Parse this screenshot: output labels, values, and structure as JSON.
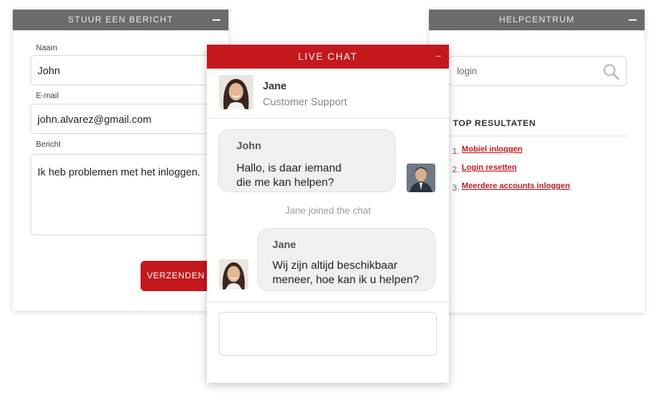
{
  "form": {
    "title": "Stuur een bericht",
    "name_label": "Naam",
    "name_value": "John",
    "email_label": "E-mail",
    "email_value": "john.alvarez@gmail.com",
    "message_label": "Bericht",
    "message_value": "Ik heb problemen met het inloggen.",
    "submit_label": "Verzenden"
  },
  "help": {
    "title": "Helpcentrum",
    "search_value": "login",
    "results_title": "Top resultaten",
    "results": [
      {
        "num": "1.",
        "label": "Mobiel inloggen"
      },
      {
        "num": "2.",
        "label": "Login resetten"
      },
      {
        "num": "3.",
        "label": "Meerdere accounts inloggen"
      }
    ]
  },
  "chat": {
    "title": "Live chat",
    "agent_name": "Jane",
    "agent_role": "Customer Support",
    "messages": [
      {
        "sender": "John",
        "text": "Hallo, is daar iemand\ndie me kan helpen?"
      },
      {
        "sender": "Jane",
        "text": "Wij zijn altijd beschikbaar\nmeneer, hoe kan ik u helpen?"
      }
    ],
    "status_text": "Jane joined the chat",
    "input_value": ""
  },
  "colors": {
    "accent": "#c4181d",
    "header_gray": "#6b6b6b"
  }
}
